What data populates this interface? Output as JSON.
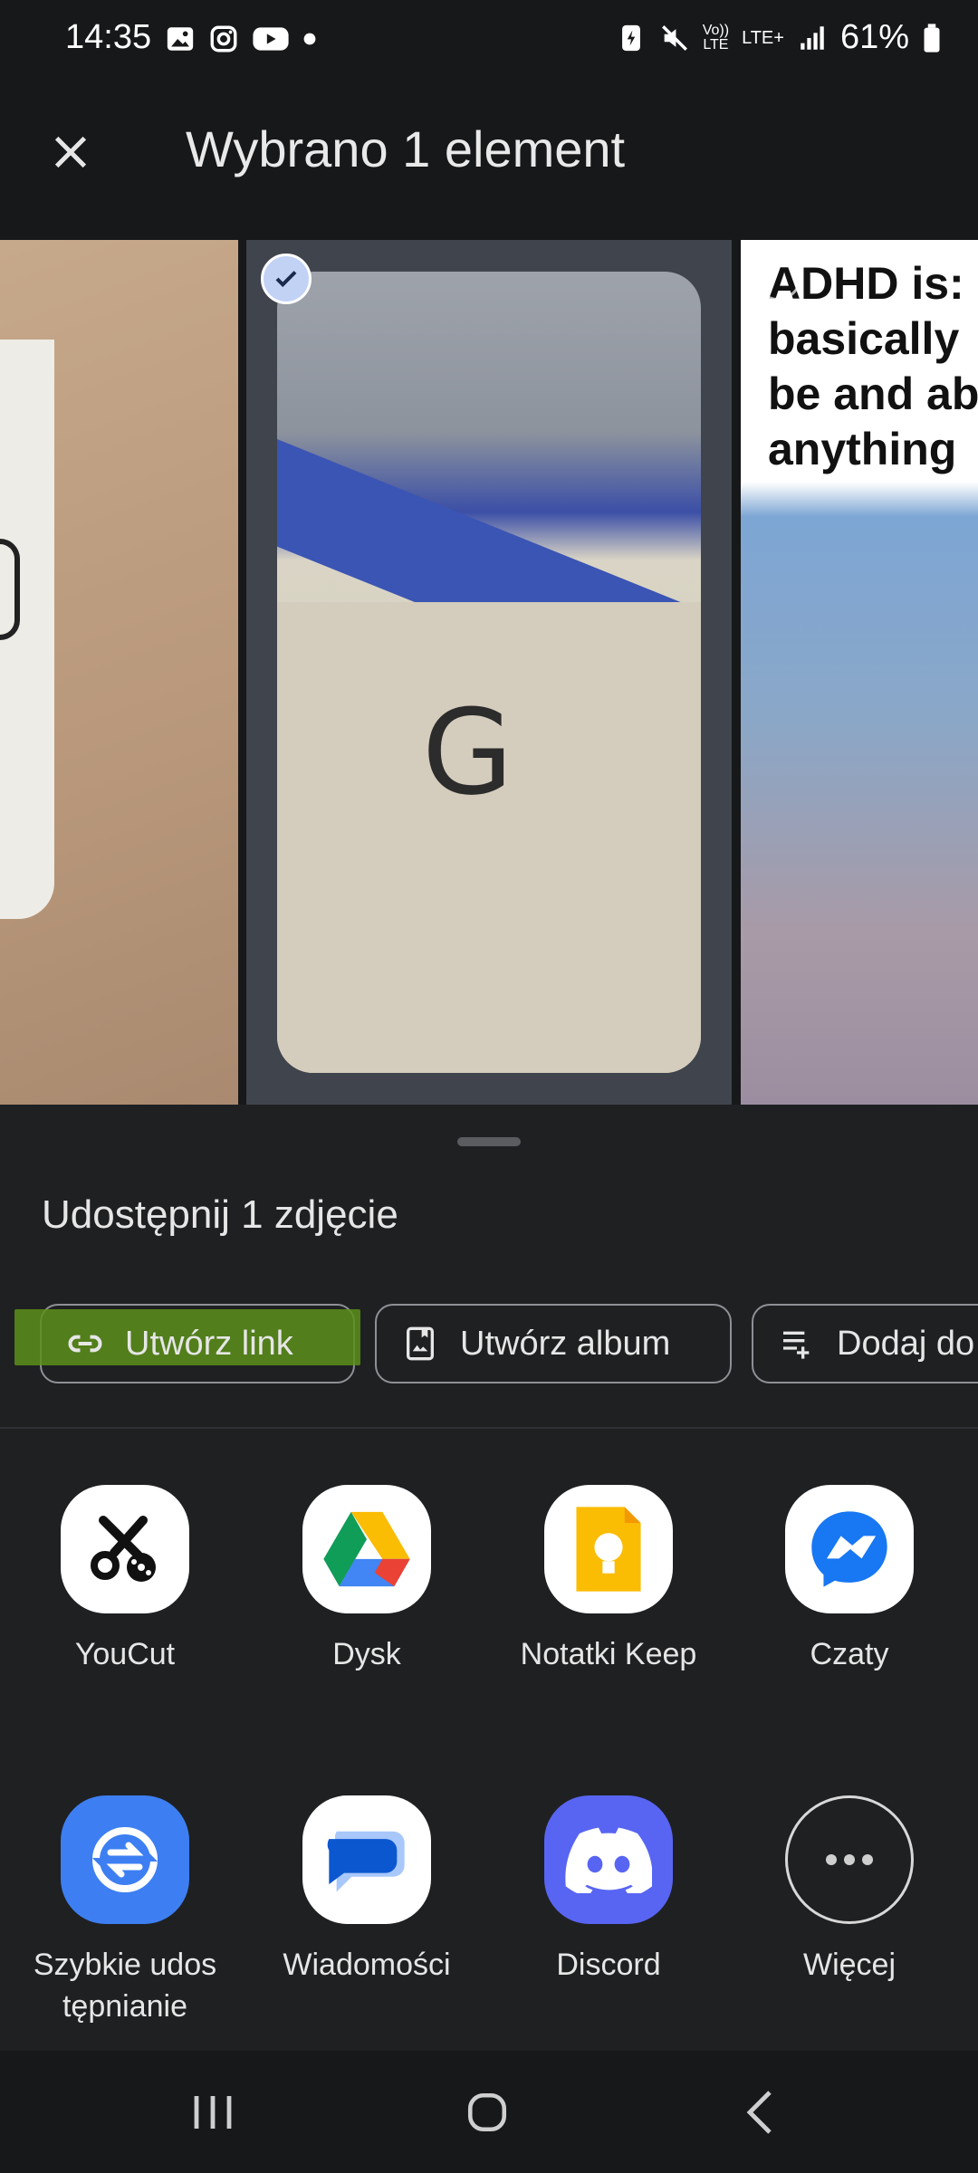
{
  "status_bar": {
    "time": "14:35",
    "battery": "61%",
    "network_top": "Vo))",
    "network_bottom": "LTE",
    "lte_label": "LTE+",
    "icons": [
      "gallery-icon",
      "instagram-icon",
      "youtube-icon",
      "dot-icon",
      "battery-saver-icon",
      "mute-icon",
      "signal-icon",
      "battery-icon"
    ]
  },
  "app_bar": {
    "title": "Wybrano 1 element",
    "close_icon": "close-icon"
  },
  "photos": {
    "selected_letter": "G",
    "meme_text": "ADHD is:\nbasically\nbe and ab\nanything"
  },
  "share_sheet": {
    "title": "Udostępnij 1 zdjęcie",
    "actions": [
      {
        "label": "Utwórz link",
        "icon": "link-icon",
        "highlight": "#5c8f1a"
      },
      {
        "label": "Utwórz album",
        "icon": "album-icon"
      },
      {
        "label": "Dodaj do",
        "icon": "playlist-add-icon"
      }
    ],
    "apps": [
      {
        "label": "YouCut",
        "icon": "youcut-icon"
      },
      {
        "label": "Dysk",
        "icon": "google-drive-icon"
      },
      {
        "label": "Notatki Keep",
        "icon": "google-keep-icon"
      },
      {
        "label": "Czaty",
        "icon": "messenger-icon"
      },
      {
        "label": "Szybkie udos\ntępnianie",
        "icon": "quick-share-icon"
      },
      {
        "label": "Wiadomości",
        "icon": "messages-icon"
      },
      {
        "label": "Discord",
        "icon": "discord-icon"
      },
      {
        "label": "Więcej",
        "icon": "more-icon"
      }
    ]
  },
  "nav_bar": {
    "buttons": [
      "recent-apps-icon",
      "home-icon",
      "back-icon"
    ]
  },
  "colors": {
    "background": "#1f2022",
    "bar": "#17181a",
    "selection_check": "#c2d2f5",
    "messenger": "#1877f2",
    "discord": "#5865f2",
    "quick_share": "#3d7ff2"
  }
}
